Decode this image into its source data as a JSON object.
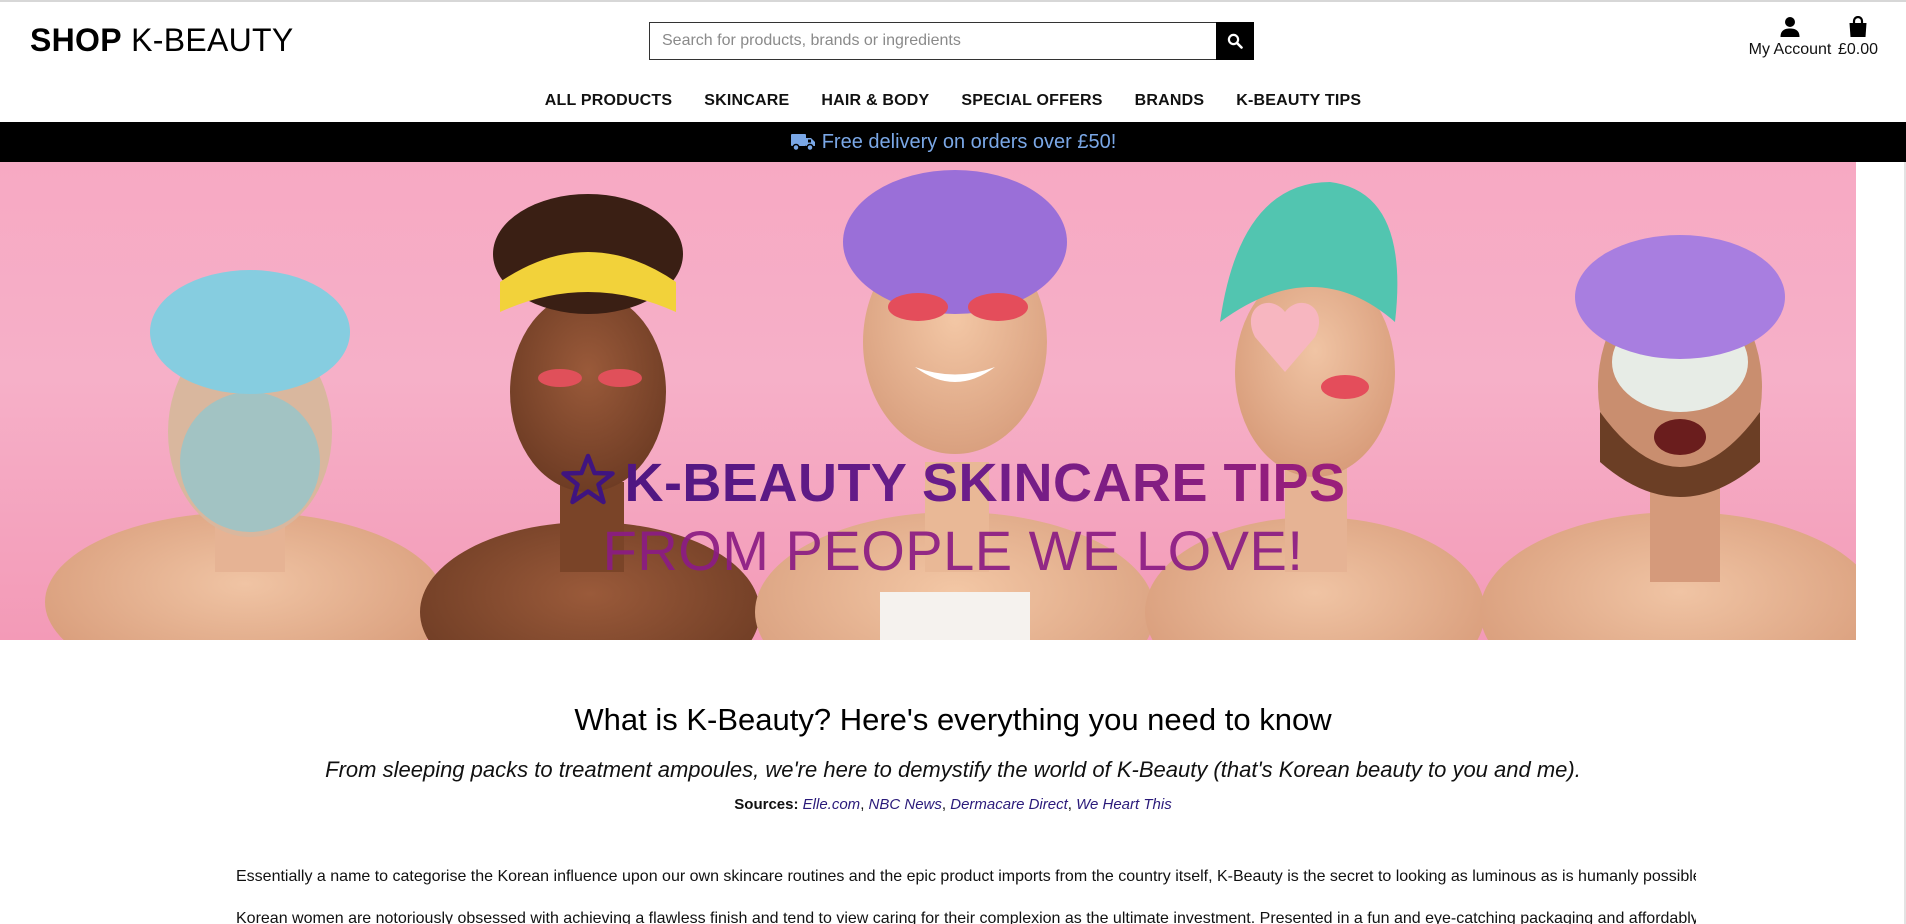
{
  "header": {
    "logo_bold": "SHOP",
    "logo_light": "K-BEAUTY",
    "search": {
      "placeholder": "Search for products, brands or ingredients",
      "value": "",
      "button_icon": "search-icon"
    },
    "account_label": "My Account",
    "account_icon": "user-icon",
    "bag_total": "£0.00",
    "bag_icon": "shopping-bag-icon"
  },
  "nav": {
    "items": [
      {
        "label": "ALL PRODUCTS"
      },
      {
        "label": "SKINCARE"
      },
      {
        "label": "HAIR & BODY"
      },
      {
        "label": "SPECIAL OFFERS"
      },
      {
        "label": "BRANDS"
      },
      {
        "label": "K-BEAUTY TIPS"
      }
    ]
  },
  "banner": {
    "icon": "truck-icon",
    "text": "Free delivery on orders over £50!",
    "color": "#7aa7e6"
  },
  "hero": {
    "title": "K-BEAUTY SKINCARE TIPS",
    "subtitle": "FROM PEOPLE WE LOVE!",
    "title_icon": "star-icon",
    "background": "#f7a9c3"
  },
  "article": {
    "heading": "What is K-Beauty? Here's everything you need to know",
    "intro": "From sleeping packs to treatment ampoules, we're here to demystify the world of K-Beauty (that's Korean beauty to you and me).",
    "sources_label": "Sources:",
    "sources": [
      {
        "label": "Elle.com"
      },
      {
        "label": "NBC News"
      },
      {
        "label": "Dermacare Direct"
      },
      {
        "label": "We Heart This"
      }
    ],
    "paragraphs": [
      "Essentially a name to categorise the Korean influence upon our own skincare routines and the epic product imports from the country itself, K-Beauty is the secret to looking as luminous as is humanly possible.",
      "Korean women are notoriously obsessed with achieving a flawless finish and tend to view caring for their complexion as the ultimate investment. Presented in a fun and eye-catching packaging and affordably"
    ]
  }
}
